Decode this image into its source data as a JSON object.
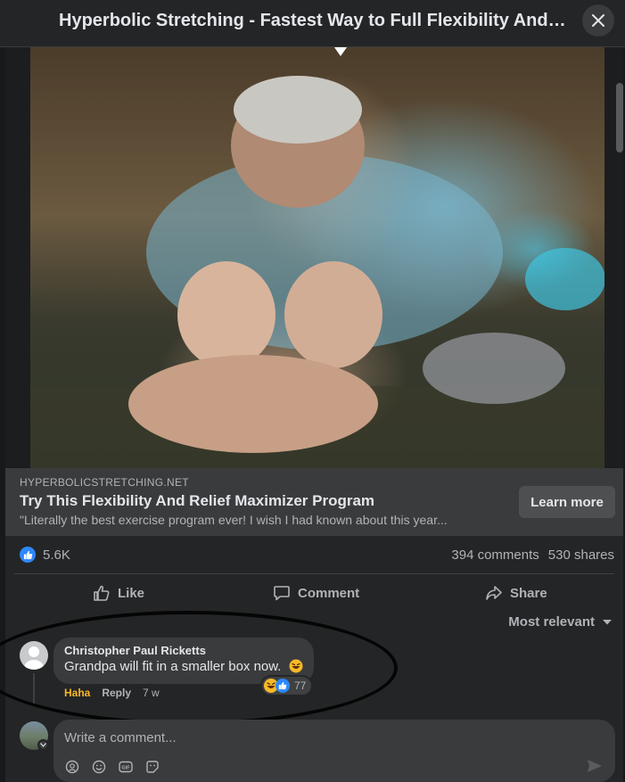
{
  "header": {
    "title": "Hyperbolic Stretching - Fastest Way to Full Flexibility And ..."
  },
  "link": {
    "domain": "HYPERBOLICSTRETCHING.NET",
    "headline": "Try This Flexibility And Relief Maximizer Program",
    "description": "\"Literally the best exercise program ever! I wish I had known about this year...",
    "cta": "Learn more"
  },
  "stats": {
    "likes": "5.6K",
    "comments": "394 comments",
    "shares": "530 shares"
  },
  "actions": {
    "like": "Like",
    "comment": "Comment",
    "share": "Share"
  },
  "sort": {
    "label": "Most relevant"
  },
  "comment": {
    "author": "Christopher Paul Ricketts",
    "text": "Grandpa will fit in a smaller box now.",
    "reaction_count": "77",
    "haha": "Haha",
    "reply": "Reply",
    "time": "7 w"
  },
  "composer": {
    "placeholder": "Write a comment..."
  },
  "icons": [
    "close-icon",
    "like-icon",
    "comment-icon",
    "share-icon",
    "chevron-down-icon",
    "emoji-icon",
    "gif-icon",
    "sticker-icon",
    "avatar-icon",
    "send-icon"
  ],
  "colors": {
    "background": "#18191a",
    "surface": "#242526",
    "accent": "#2d88ff",
    "haha": "#f7b928"
  }
}
